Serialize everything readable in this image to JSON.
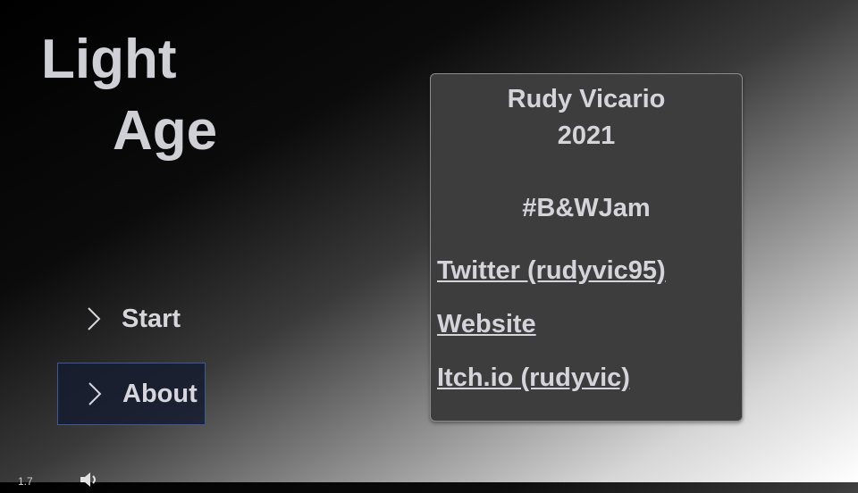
{
  "title": {
    "line1": "Light",
    "line2": "Age"
  },
  "menu": {
    "items": [
      {
        "label": "Start",
        "icon": "chevron-right-icon"
      },
      {
        "label": "About",
        "icon": "chevron-right-icon",
        "selected": true
      }
    ]
  },
  "about": {
    "author": "Rudy Vicario",
    "year": "2021",
    "jam": "#B&WJam",
    "links": [
      {
        "label": "Twitter (rudyvic95)"
      },
      {
        "label": "Website"
      },
      {
        "label": "Itch.io (rudyvic)"
      }
    ]
  },
  "footer": {
    "version": "1.7",
    "volume_icon": "speaker-icon"
  },
  "colors": {
    "selection_bg": "#161c30",
    "selection_border": "#3c5a9a",
    "panel_bg": "#3d3d3e",
    "text": "#d4d4da"
  }
}
